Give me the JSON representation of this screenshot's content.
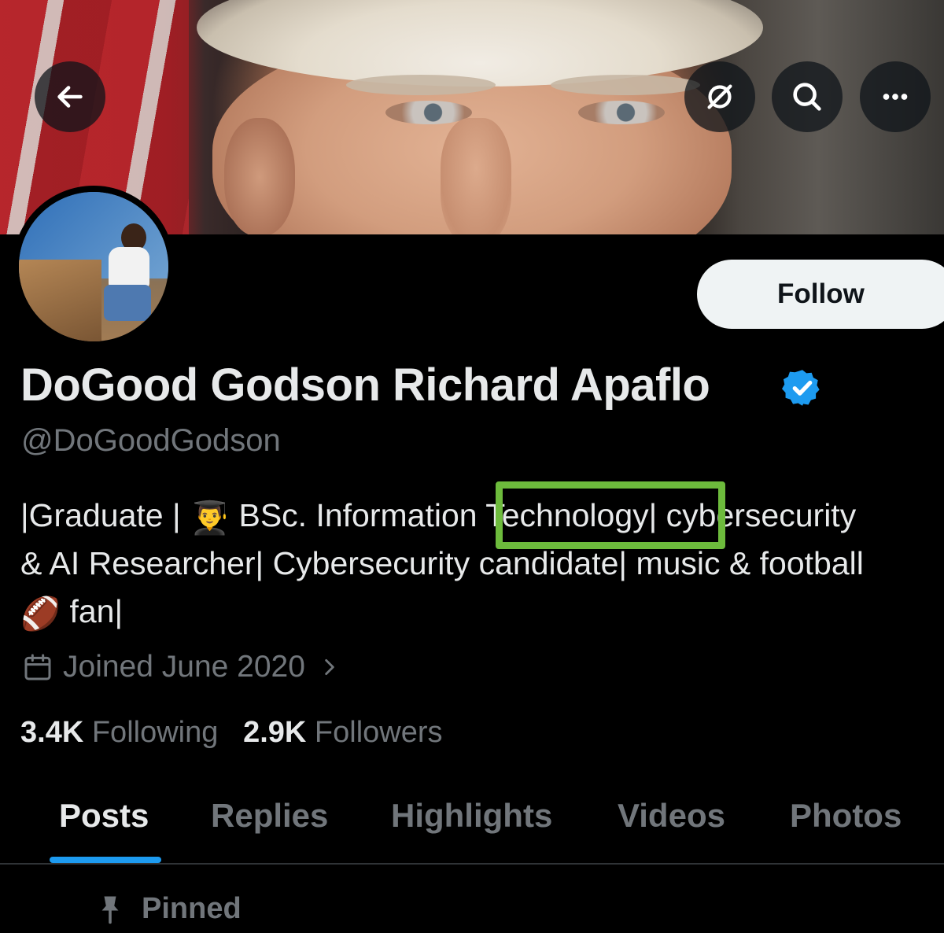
{
  "header": {
    "back_icon": "arrow-left-icon",
    "grok_icon": "grok-icon",
    "search_icon": "search-icon",
    "more_icon": "more-horizontal-icon"
  },
  "profile": {
    "name": "DoGood Godson Richard Apaflo",
    "verified": true,
    "handle": "@DoGoodGodson",
    "follow_label": "Follow",
    "bio": {
      "line1_part1": "|Graduate | ",
      "line1_emoji": "👨‍🎓",
      "line1_part2": " BSc. Information Technology| cybersecurity",
      "line2": "& AI Researcher| Cybersecurity candidate| music & football",
      "line3_emoji": "🏈",
      "line3_text": " fan|"
    },
    "joined": "Joined June 2020",
    "following_count": "3.4K",
    "following_label": "Following",
    "followers_count": "2.9K",
    "followers_label": "Followers"
  },
  "tabs": [
    "Posts",
    "Replies",
    "Highlights",
    "Videos",
    "Photos"
  ],
  "active_tab": "Posts",
  "pinned_label": "Pinned",
  "colors": {
    "background": "#000000",
    "text_primary": "#e7e9ea",
    "text_secondary": "#71767b",
    "accent": "#1d9bf0",
    "highlight_box": "#6dbb3c"
  }
}
